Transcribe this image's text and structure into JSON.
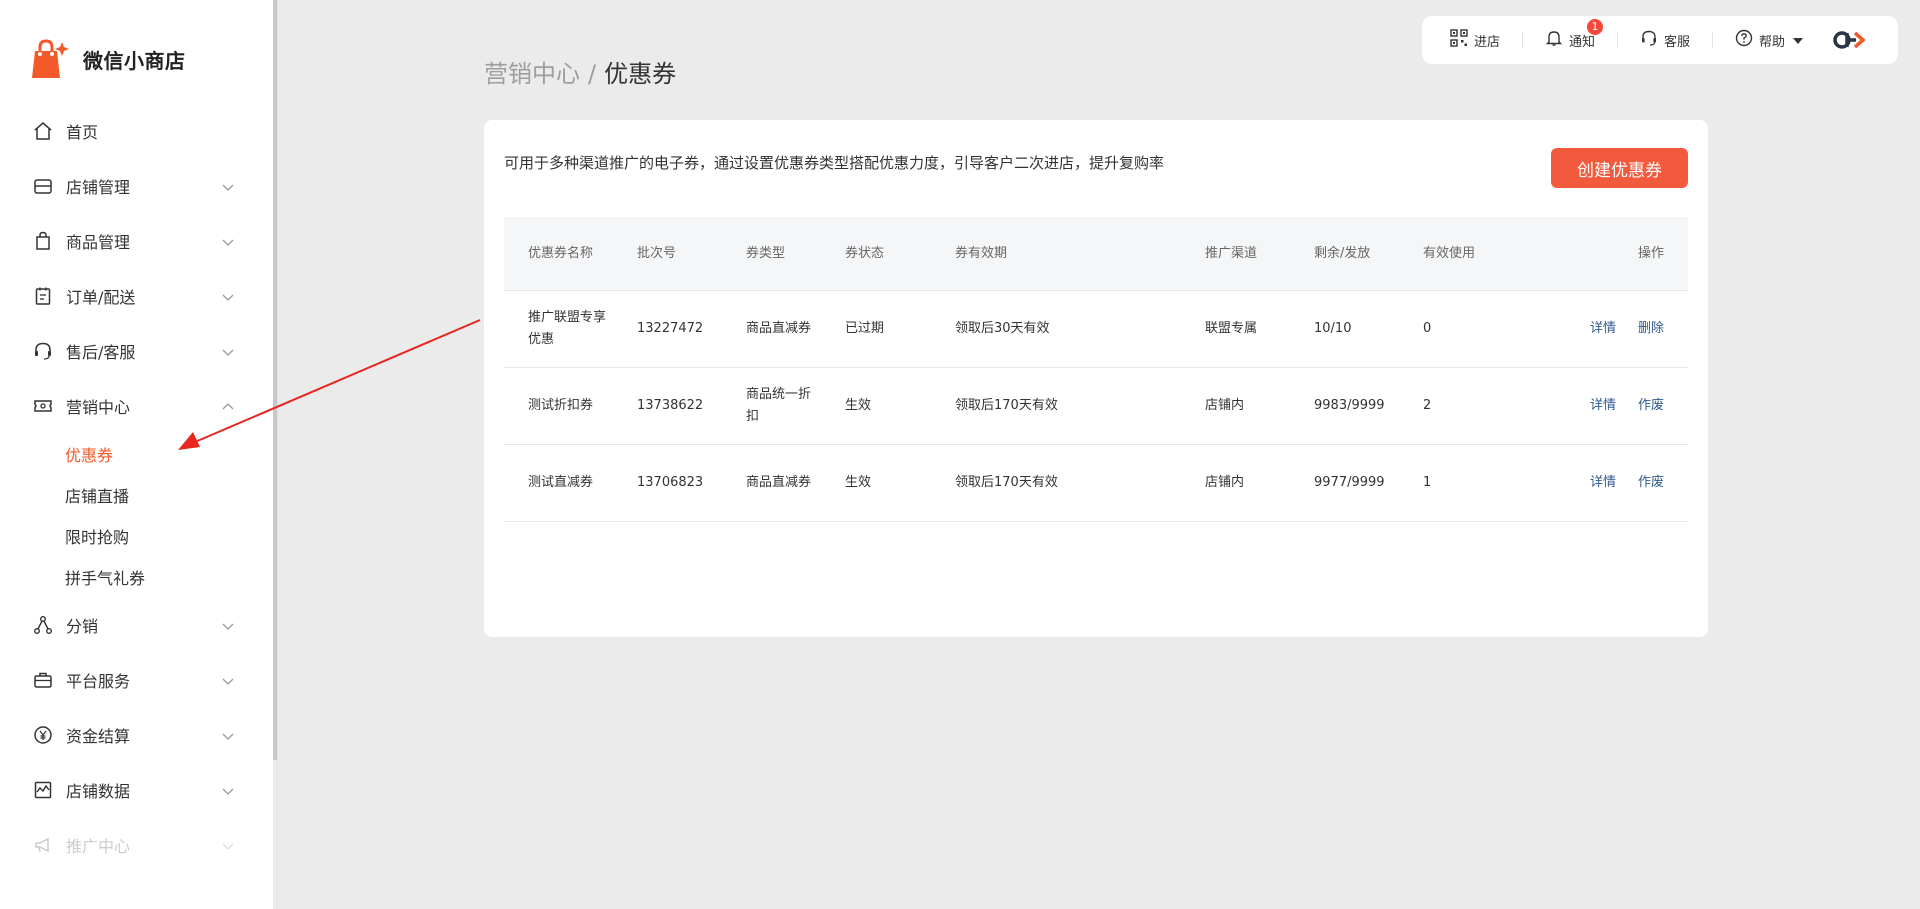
{
  "app": {
    "name": "微信小商店"
  },
  "sidebar": {
    "items": [
      {
        "label": "首页",
        "icon": "home-icon",
        "expandable": false
      },
      {
        "label": "店铺管理",
        "icon": "store-icon",
        "expandable": true
      },
      {
        "label": "商品管理",
        "icon": "bag-icon",
        "expandable": true
      },
      {
        "label": "订单/配送",
        "icon": "clipboard-icon",
        "expandable": true
      },
      {
        "label": "售后/客服",
        "icon": "headset-icon",
        "expandable": true
      },
      {
        "label": "营销中心",
        "icon": "ticket-icon",
        "expandable": true,
        "expanded": true,
        "children": [
          {
            "label": "优惠券",
            "active": true
          },
          {
            "label": "店铺直播"
          },
          {
            "label": "限时抢购"
          },
          {
            "label": "拼手气礼券"
          }
        ]
      },
      {
        "label": "分销",
        "icon": "share-nodes-icon",
        "expandable": true
      },
      {
        "label": "平台服务",
        "icon": "briefcase-icon",
        "expandable": true
      },
      {
        "label": "资金结算",
        "icon": "yen-coin-icon",
        "expandable": true
      },
      {
        "label": "店铺数据",
        "icon": "chart-icon",
        "expandable": true
      },
      {
        "label": "推广中心",
        "icon": "megaphone-icon",
        "expandable": true,
        "faded": true
      }
    ]
  },
  "topbar": {
    "enter_store": "进店",
    "notifications": "通知",
    "notification_count": "1",
    "customer_service": "客服",
    "help": "帮助"
  },
  "breadcrumb": {
    "parent": "营销中心",
    "separator": "/",
    "current": "优惠券"
  },
  "card": {
    "description": "可用于多种渠道推广的电子券，通过设置优惠券类型搭配优惠力度，引导客户二次进店，提升复购率",
    "create_button": "创建优惠券"
  },
  "table": {
    "headers": [
      "优惠券名称",
      "批次号",
      "券类型",
      "券状态",
      "券有效期",
      "推广渠道",
      "剩余/发放",
      "有效使用",
      "操作"
    ],
    "rows": [
      {
        "name": "推广联盟专享优惠",
        "batch": "13227472",
        "type": "商品直减券",
        "status": "已过期",
        "validity": "领取后30天有效",
        "channel": "联盟专属",
        "remaining": "10/10",
        "used": "0",
        "actions": [
          "详情",
          "删除"
        ]
      },
      {
        "name": "测试折扣券",
        "batch": "13738622",
        "type": "商品统一折扣",
        "status": "生效",
        "validity": "领取后170天有效",
        "channel": "店铺内",
        "remaining": "9983/9999",
        "used": "2",
        "actions": [
          "详情",
          "作废"
        ]
      },
      {
        "name": "测试直减券",
        "batch": "13706823",
        "type": "商品直减券",
        "status": "生效",
        "validity": "领取后170天有效",
        "channel": "店铺内",
        "remaining": "9977/9999",
        "used": "1",
        "actions": [
          "详情",
          "作废"
        ]
      }
    ]
  },
  "colors": {
    "accent": "#f25a3d",
    "active_nav": "#f25a2a",
    "link": "#2f5a8f",
    "annotation": "#e8251f",
    "background": "#ebebeb"
  }
}
